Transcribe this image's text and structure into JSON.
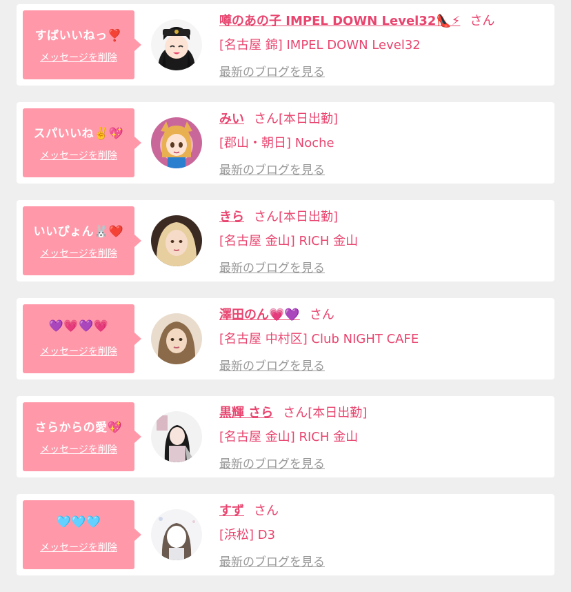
{
  "cards": [
    {
      "message": "すばいいねっ❣️",
      "delete_label": "メッセージを削除",
      "name": "噂のあの子 IMPEL DOWN Level32👠⚡",
      "honorific": "さん",
      "shift": "",
      "shop": "[名古屋 錦] IMPEL DOWN Level32",
      "blog_label": "最新のブログを見る",
      "avatar_icon": "anime-girl-police-avatar"
    },
    {
      "message": "スパいいね✌️💖",
      "delete_label": "メッセージを削除",
      "name": "みい",
      "honorific": "さん",
      "shift": "[本日出勤]",
      "shop": "[郡山・朝日] Noche",
      "blog_label": "最新のブログを見る",
      "avatar_icon": "anime-cat-girl-avatar"
    },
    {
      "message": "いいぴょん🐰❤️",
      "delete_label": "メッセージを削除",
      "name": "きら",
      "honorific": "さん",
      "shift": "[本日出勤]",
      "shop": "[名古屋 金山] RICH 金山",
      "blog_label": "最新のブログを見る",
      "avatar_icon": "blonde-woman-photo-avatar"
    },
    {
      "message": "💜💗💜💗",
      "delete_label": "メッセージを削除",
      "name": "澤田のん💗💜",
      "honorific": "さん",
      "shift": "",
      "shop": "[名古屋 中村区] Club NIGHT CAFE",
      "blog_label": "最新のブログを見る",
      "avatar_icon": "woman-photo-avatar"
    },
    {
      "message": "さらからの愛💖",
      "delete_label": "メッセージを削除",
      "name": "黒輝 さら",
      "honorific": "さん",
      "shift": "[本日出勤]",
      "shop": "[名古屋 金山] RICH 金山",
      "blog_label": "最新のブログを見る",
      "avatar_icon": "magazine-cover-avatar"
    },
    {
      "message": "🩵🩵🩵",
      "delete_label": "メッセージを削除",
      "name": "すず",
      "honorific": "さん",
      "shift": "",
      "shop": "[浜松] D3",
      "blog_label": "最新のブログを見る",
      "avatar_icon": "blurred-face-avatar"
    }
  ],
  "colors": {
    "accent_pink": "#e8456f",
    "bubble_pink": "#ff99aa",
    "blog_gray": "#999999",
    "page_bg": "#f0eff0"
  }
}
